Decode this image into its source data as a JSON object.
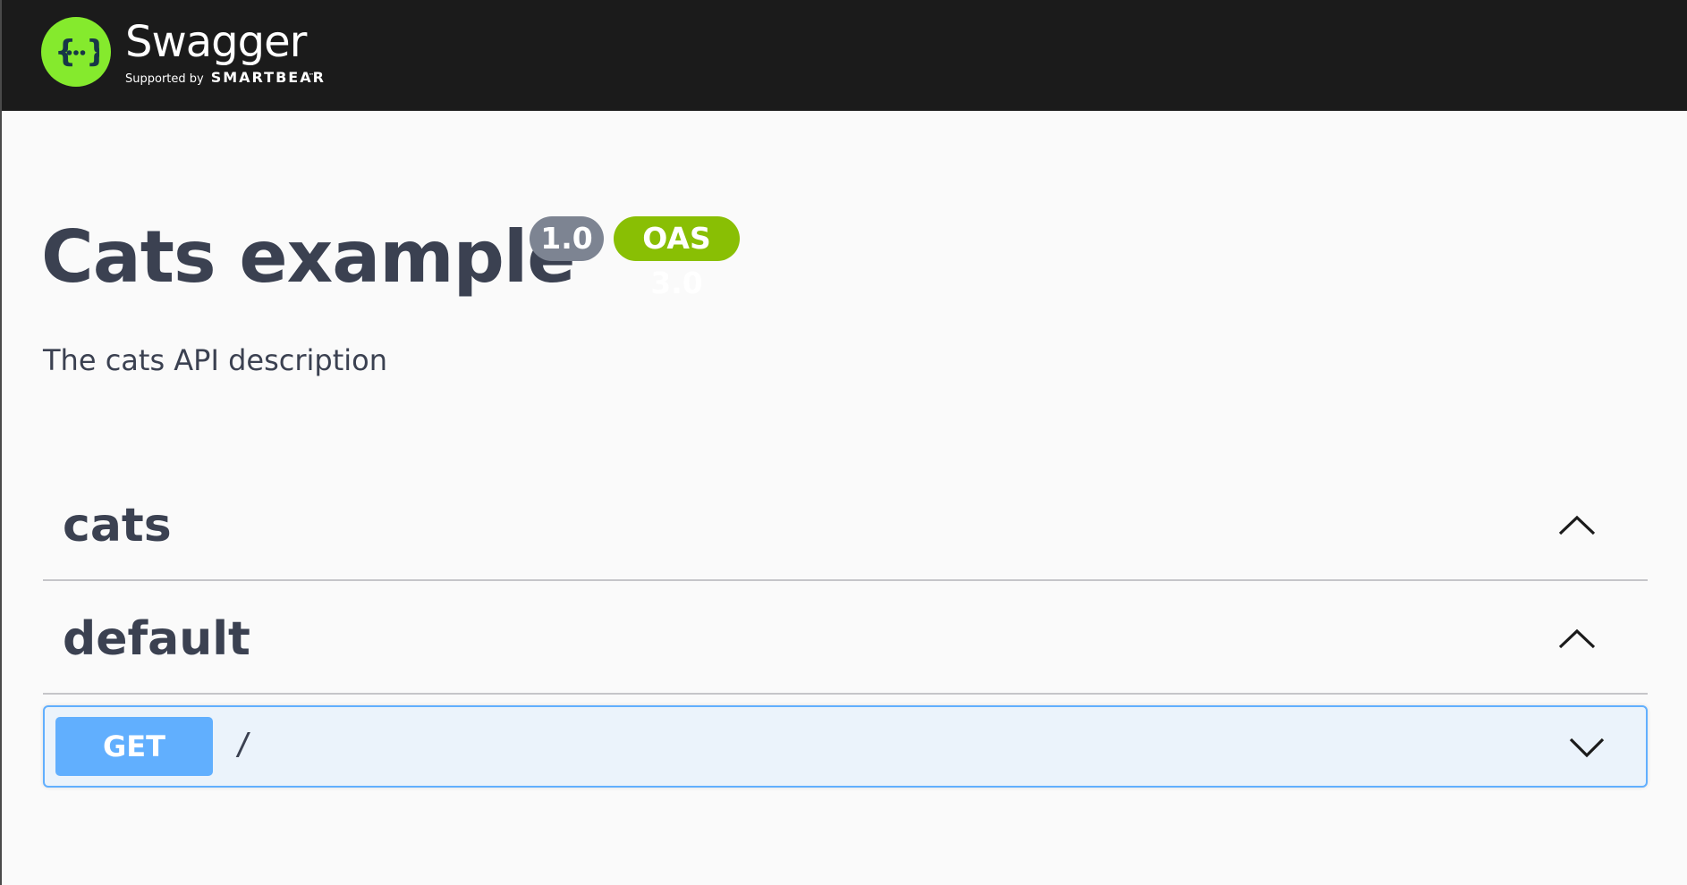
{
  "topbar": {
    "logo_name": "Swagger",
    "logo_tm": "™",
    "supported_by": "Supported by",
    "brand": "SMARTBEAR",
    "logo_color": "#85ea2d",
    "background": "#1b1b1b"
  },
  "info": {
    "title": "Cats example",
    "version": "1.0",
    "oas_version": "OAS 3.0",
    "description": "The cats API description"
  },
  "tags": [
    {
      "name": "cats",
      "expanded": true,
      "icon": "chevron-up-icon"
    },
    {
      "name": "default",
      "expanded": true,
      "icon": "chevron-up-icon"
    }
  ],
  "operations": [
    {
      "method": "GET",
      "path": "/",
      "method_color": "#61affe",
      "icon": "chevron-down-icon"
    }
  ],
  "colors": {
    "text": "#3b4151",
    "version_badge": "#7d8492",
    "oas_badge": "#89bf04",
    "get_background": "#ebf3fb"
  }
}
